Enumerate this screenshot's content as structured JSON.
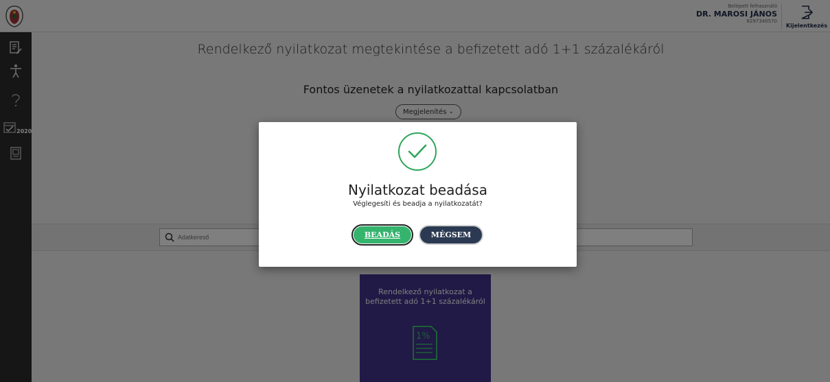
{
  "header": {
    "user_label": "Belépett felhasználó",
    "user_name": "DR. MAROSI JÁNOS",
    "user_id": "8297340570",
    "logout_label": "Kijelentkezés"
  },
  "sidebar": {
    "items": [
      {
        "icon": "document-edit-icon"
      },
      {
        "icon": "accessibility-icon"
      },
      {
        "icon": "help-icon"
      },
      {
        "icon": "calendar-2020-icon",
        "label": "2020"
      },
      {
        "icon": "book-icon"
      }
    ]
  },
  "main": {
    "page_title": "Rendelkező nyilatkozat megtekintése a befizetett adó 1+1 százalékáról",
    "section_title": "Fontos üzenetek a nyilatkozattal kapcsolatban",
    "show_button": "Megjelenítés",
    "search_placeholder": "Adatkereső",
    "card_text": "Rendelkező nyilatkozat a befizetett adó 1+1 százalékáról",
    "card_icon_text": "1%"
  },
  "modal": {
    "title": "Nyilatkozat beadása",
    "subtitle": "Véglegesíti és beadja a nyilatkozatát?",
    "submit_label": "BEADÁS",
    "cancel_label": "MÉGSEM"
  },
  "colors": {
    "accent_green": "#35b46d",
    "cancel_dark": "#2b3a52",
    "card_purple": "#43338c",
    "sidebar_dark": "#2c2c2c"
  }
}
